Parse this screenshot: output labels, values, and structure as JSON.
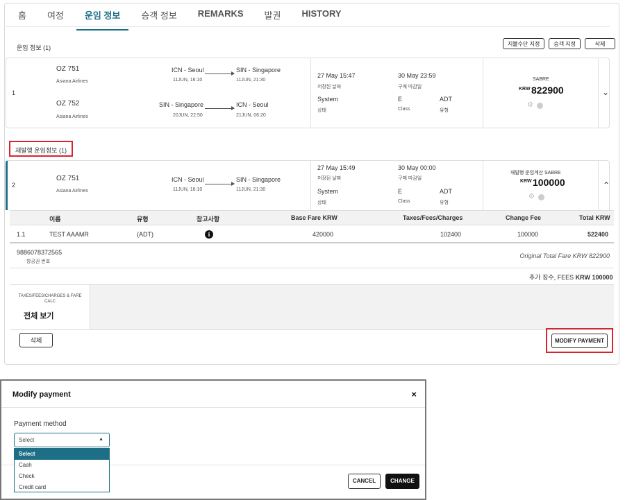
{
  "tabs": [
    "홈",
    "여정",
    "운임 정보",
    "승객 정보",
    "REMARKS",
    "발권",
    "HISTORY"
  ],
  "fare_section_label": "운임 정보 (1)",
  "top_buttons": [
    "지불수단 지정",
    "승객 지정",
    "삭제"
  ],
  "fare1": {
    "index": "1",
    "segments": [
      {
        "flight": "OZ 751",
        "airline": "Asiana Airlines",
        "from": "ICN - Seoul",
        "from_time": "11JUN, 16:10",
        "to": "SIN - Singapore",
        "to_time": "11JUN, 21:30"
      },
      {
        "flight": "OZ 752",
        "airline": "Asiana Airlines",
        "from": "SIN - Singapore",
        "from_time": "20JUN, 22:50",
        "to": "ICN - Seoul",
        "to_time": "21JUN, 06:20"
      }
    ],
    "saved_date": "27 May 15:47",
    "saved_label": "저장된 날짜",
    "deadline": "30 May 23:59",
    "deadline_label": "구매 마감일",
    "status": "System",
    "status_label": "상태",
    "class_val": "E",
    "class_label": "Class",
    "type_val": "ADT",
    "type_label": "유형",
    "source": "SABRE",
    "currency": "KRW",
    "amount": "822900"
  },
  "reissue_label": "재발행 운임정보 (1)",
  "fare2": {
    "index": "2",
    "segment": {
      "flight": "OZ 751",
      "airline": "Asiana Airlines",
      "from": "ICN - Seoul",
      "from_time": "11JUN, 16:10",
      "to": "SIN - Singapore",
      "to_time": "11JUN, 21:30"
    },
    "saved_date": "27 May 15:49",
    "saved_label": "저장된 날짜",
    "deadline": "30 May 00:00",
    "deadline_label": "구매 마감일",
    "status": "System",
    "status_label": "상태",
    "class_val": "E",
    "class_label": "Class",
    "type_val": "ADT",
    "type_label": "유형",
    "source": "재발행 운임계산 SABRE",
    "currency": "KRW",
    "amount": "100000"
  },
  "table": {
    "headers": [
      "이름",
      "유형",
      "참고사항",
      "Base Fare KRW",
      "Taxes/Fees/Charges",
      "Change Fee",
      "Total KRW"
    ],
    "row": {
      "no": "1.1",
      "name": "TEST AAAMR",
      "type": "(ADT)",
      "base": "420000",
      "taxes": "102400",
      "change": "100000",
      "total": "522400"
    }
  },
  "ticket": {
    "number": "9886078372565",
    "label": "항공권 번호",
    "original_total": "Original Total Fare KRW 822900"
  },
  "extra_fee": {
    "prefix": "추가 징수, FEES",
    "amount": "KRW 100000"
  },
  "taxes_box": {
    "title": "TAXES/FEES/CHARGES & FARE CALC",
    "link": "전체 보기"
  },
  "delete_button": "삭제",
  "modify_payment_button": "MODIFY PAYMENT",
  "modal": {
    "title": "Modify payment",
    "close": "×",
    "payment_label": "Payment method",
    "select_value": "Select",
    "options": [
      "Select",
      "Cash",
      "Check",
      "Credit card"
    ],
    "cancel": "CANCEL",
    "change": "CHANGE"
  },
  "colors": {
    "accent": "#1c6f86",
    "highlight": "#d9232e"
  }
}
